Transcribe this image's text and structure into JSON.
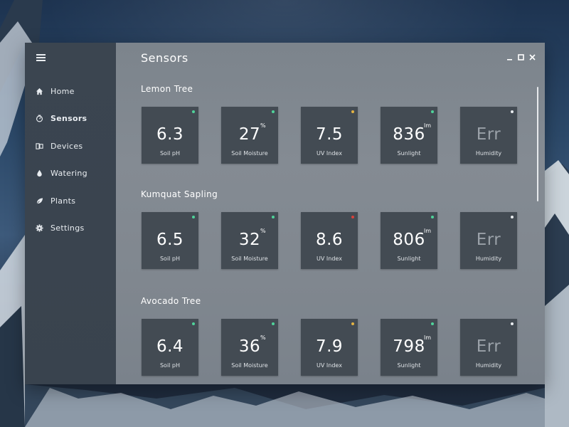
{
  "window": {
    "title": "Sensors",
    "controls": [
      "minimize",
      "maximize",
      "close"
    ]
  },
  "sidebar": {
    "items": [
      {
        "label": "Home",
        "icon": "home-icon",
        "active": false
      },
      {
        "label": "Sensors",
        "icon": "sensor-gauge-icon",
        "active": true
      },
      {
        "label": "Devices",
        "icon": "devices-icon",
        "active": false
      },
      {
        "label": "Watering",
        "icon": "water-drop-icon",
        "active": false
      },
      {
        "label": "Plants",
        "icon": "leaf-icon",
        "active": false
      },
      {
        "label": "Settings",
        "icon": "gear-icon",
        "active": false
      }
    ]
  },
  "colors": {
    "status_ok": "#4fd39a",
    "status_warn": "#e3b343",
    "status_alert": "#d9413b",
    "status_unknown": "#e8ecef"
  },
  "groups": [
    {
      "name": "Lemon Tree",
      "sensors": [
        {
          "value": "6.3",
          "unit": "",
          "label": "Soil pH",
          "status": "ok"
        },
        {
          "value": "27",
          "unit": "%",
          "label": "Soil Moisture",
          "status": "ok"
        },
        {
          "value": "7.5",
          "unit": "",
          "label": "UV Index",
          "status": "warn"
        },
        {
          "value": "836",
          "unit": "lm",
          "label": "Sunlight",
          "status": "ok"
        },
        {
          "value": "Err",
          "unit": "",
          "label": "Humidity",
          "status": "unknown"
        }
      ]
    },
    {
      "name": "Kumquat Sapling",
      "sensors": [
        {
          "value": "6.5",
          "unit": "",
          "label": "Soil pH",
          "status": "ok"
        },
        {
          "value": "32",
          "unit": "%",
          "label": "Soil Moisture",
          "status": "ok"
        },
        {
          "value": "8.6",
          "unit": "",
          "label": "UV Index",
          "status": "alert"
        },
        {
          "value": "806",
          "unit": "lm",
          "label": "Sunlight",
          "status": "ok"
        },
        {
          "value": "Err",
          "unit": "",
          "label": "Humidity",
          "status": "unknown"
        }
      ]
    },
    {
      "name": "Avocado Tree",
      "sensors": [
        {
          "value": "6.4",
          "unit": "",
          "label": "Soil pH",
          "status": "ok"
        },
        {
          "value": "36",
          "unit": "%",
          "label": "Soil Moisture",
          "status": "ok"
        },
        {
          "value": "7.9",
          "unit": "",
          "label": "UV Index",
          "status": "warn"
        },
        {
          "value": "798",
          "unit": "lm",
          "label": "Sunlight",
          "status": "ok"
        },
        {
          "value": "Err",
          "unit": "",
          "label": "Humidity",
          "status": "unknown"
        }
      ]
    }
  ]
}
